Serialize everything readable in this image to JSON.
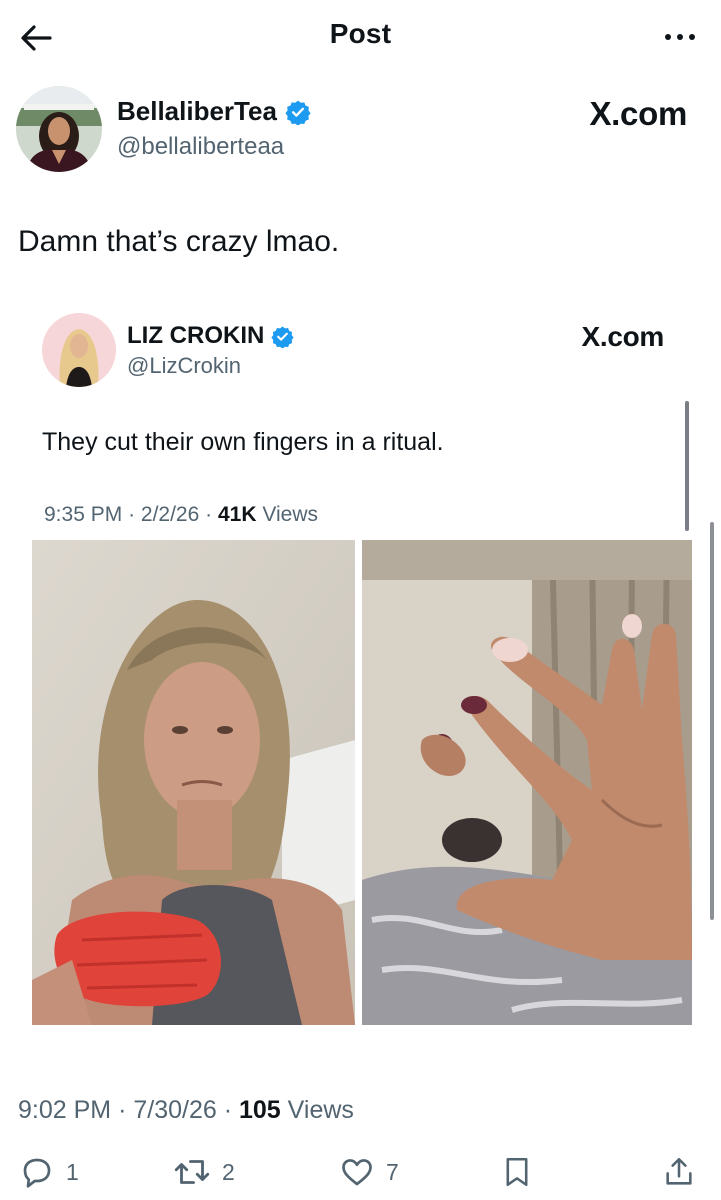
{
  "header": {
    "title": "Post",
    "back_icon": "arrow-left-icon",
    "more_icon": "more-horizontal-icon"
  },
  "post": {
    "author_name": "BellaliberTea",
    "author_handle": "@bellaliberteaa",
    "watermark": "X.com",
    "text": "Damn that’s crazy lmao.",
    "time": "9:02 PM",
    "date": "7/30/26",
    "views_count": "105",
    "views_label": "Views",
    "separator": "·"
  },
  "quoted": {
    "author_name": "LIZ CROKIN",
    "author_handle": "@LizCrokin",
    "watermark": "X.com",
    "text": "They cut their own fingers in a ritual.",
    "time": "9:35 PM",
    "date": "2/2/26",
    "views_count": "41K",
    "views_label": "Views",
    "separator": "·"
  },
  "actions": {
    "reply_count": "1",
    "retweet_count": "2",
    "like_count": "7"
  },
  "colors": {
    "text": "#0f1419",
    "secondary": "#536471",
    "verified": "#1d9bf0",
    "background": "#ffffff"
  }
}
